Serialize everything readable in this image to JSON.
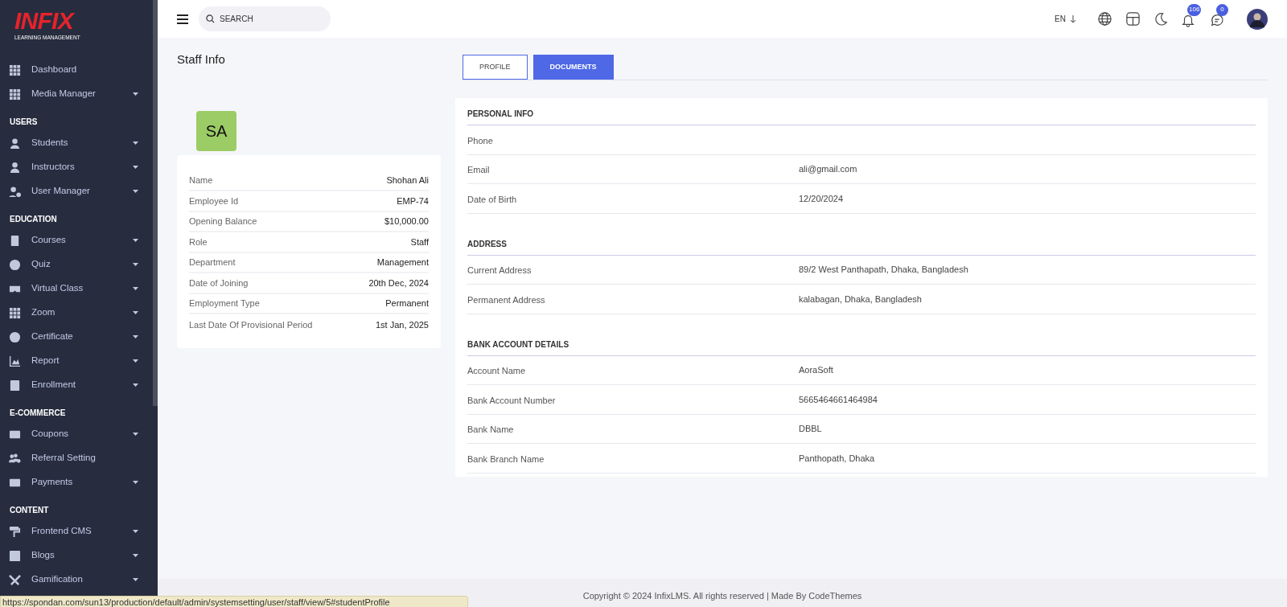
{
  "sidebar": {
    "logo": {
      "text": "INFIX",
      "subtitle": "LEARNING MANAGEMENT"
    },
    "sections": [
      {
        "items": [
          {
            "label": "Dashboard",
            "expandable": false
          },
          {
            "label": "Media Manager",
            "expandable": true
          }
        ]
      },
      {
        "title": "USERS",
        "items": [
          {
            "label": "Students",
            "expandable": true
          },
          {
            "label": "Instructors",
            "expandable": true
          },
          {
            "label": "User Manager",
            "expandable": true
          }
        ]
      },
      {
        "title": "EDUCATION",
        "items": [
          {
            "label": "Courses",
            "expandable": true
          },
          {
            "label": "Quiz",
            "expandable": true
          },
          {
            "label": "Virtual Class",
            "expandable": true
          },
          {
            "label": "Zoom",
            "expandable": true
          },
          {
            "label": "Certificate",
            "expandable": true
          },
          {
            "label": "Report",
            "expandable": true
          },
          {
            "label": "Enrollment",
            "expandable": true
          }
        ]
      },
      {
        "title": "E-COMMERCE",
        "items": [
          {
            "label": "Coupons",
            "expandable": true
          },
          {
            "label": "Referral Setting",
            "expandable": false
          },
          {
            "label": "Payments",
            "expandable": true
          }
        ]
      },
      {
        "title": "CONTENT",
        "items": [
          {
            "label": "Frontend CMS",
            "expandable": true
          },
          {
            "label": "Blogs",
            "expandable": true
          },
          {
            "label": "Gamification",
            "expandable": true
          }
        ]
      }
    ]
  },
  "header": {
    "search": {
      "placeholder": "SEARCH"
    },
    "language": "EN",
    "notifications_count": "106",
    "messages_count": "0"
  },
  "page_title": "Staff Info",
  "tabs": [
    {
      "label": "PROFILE",
      "selected": false
    },
    {
      "label": "DOCUMENTS",
      "selected": true
    }
  ],
  "profile_card": {
    "initials": "SA",
    "fields": [
      {
        "label": "Name",
        "value": "Shohan Ali"
      },
      {
        "label": "Employee Id",
        "value": "EMP-74"
      },
      {
        "label": "Opening Balance",
        "value": "$10,000.00"
      },
      {
        "label": "Role",
        "value": "Staff"
      },
      {
        "label": "Department",
        "value": "Management"
      },
      {
        "label": "Date of Joining",
        "value": "20th Dec, 2024"
      },
      {
        "label": "Employment Type",
        "value": "Permanent"
      },
      {
        "label": "Last Date Of Provisional Period",
        "value": "1st Jan, 2025"
      }
    ]
  },
  "details": [
    {
      "title": "PERSONAL INFO",
      "rows": [
        {
          "label": "Phone"
        },
        {
          "label": "Email",
          "value": "ali@gmail.com"
        },
        {
          "label": "Date of Birth",
          "value": "12/20/2024"
        }
      ]
    },
    {
      "title": "ADDRESS",
      "rows": [
        {
          "label": "Current Address",
          "value": "89/2 West Panthapath, Dhaka, Bangladesh"
        },
        {
          "label": "Permanent Address",
          "value": "kalabagan, Dhaka, Bangladesh"
        }
      ]
    },
    {
      "title": "BANK ACCOUNT DETAILS",
      "rows": [
        {
          "label": "Account Name",
          "value": "AoraSoft"
        },
        {
          "label": "Bank Account Number",
          "value": "5665464661464984"
        },
        {
          "label": "Bank Name",
          "value": "DBBL"
        },
        {
          "label": "Bank Branch Name",
          "value": "Panthopath, Dhaka"
        }
      ]
    }
  ],
  "footer": {
    "copyright": "Copyright © 2024 InfixLMS. All rights reserved | Made By CodeThemes"
  },
  "status_url": "https://spondan.com/sun13/production/default/admin/systemsetting/user/staff/view/5#studentProfile"
}
